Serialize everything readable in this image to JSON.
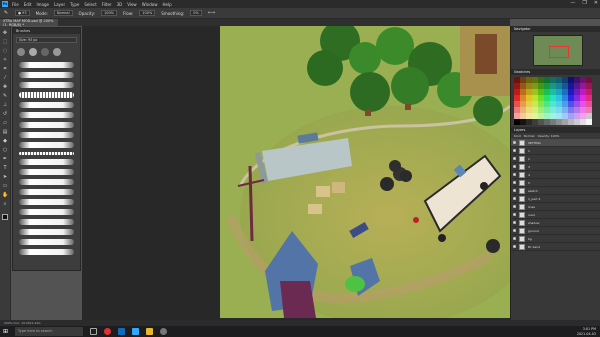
{
  "app": {
    "logo": "Ps",
    "window_controls": [
      "—",
      "❐",
      "✕"
    ]
  },
  "menu": [
    "File",
    "Edit",
    "Image",
    "Layer",
    "Type",
    "Select",
    "Filter",
    "3D",
    "View",
    "Window",
    "Help"
  ],
  "options": {
    "mode_label": "Mode:",
    "mode_value": "Normal",
    "opacity_label": "Opacity:",
    "opacity_value": "100%",
    "flow_label": "Flow:",
    "flow_value": "100%",
    "smoothing_label": "Smoothing:",
    "smoothing_value": "0%"
  },
  "document": {
    "tab_title": "XTRA MAP MOD.psd @ 200% (1, RGB/8) *"
  },
  "tools": [
    "move-icon",
    "marquee-icon",
    "lasso-icon",
    "magic-wand-icon",
    "crop-icon",
    "eyedropper-icon",
    "healing-icon",
    "brush-icon",
    "stamp-icon",
    "history-brush-icon",
    "eraser-icon",
    "gradient-icon",
    "blur-icon",
    "dodge-icon",
    "pen-icon",
    "type-icon",
    "path-select-icon",
    "rectangle-icon",
    "hand-icon",
    "zoom-icon"
  ],
  "brushes": {
    "title": "Brushes",
    "size_label": "Size:",
    "size_value": "93 px",
    "stroke_count": 20
  },
  "navigator": {
    "title": "Navigator"
  },
  "swatches": {
    "title": "Swatches"
  },
  "layers": {
    "title": "Layers",
    "kind_label": "Kind",
    "blend": "Normal",
    "opacity": "Opacity: 100%",
    "items": [
      {
        "name": "SETTING",
        "selected": true
      },
      {
        "name": "1",
        "selected": false
      },
      {
        "name": "2",
        "selected": false
      },
      {
        "name": "3",
        "selected": false
      },
      {
        "name": "4",
        "selected": false
      },
      {
        "name": "5",
        "selected": false
      },
      {
        "name": "sketch",
        "selected": false
      },
      {
        "name": "1_part 4",
        "selected": false
      },
      {
        "name": "lines",
        "selected": false
      },
      {
        "name": "road",
        "selected": false
      },
      {
        "name": "shadow",
        "selected": false
      },
      {
        "name": "ground",
        "selected": false
      },
      {
        "name": "bg",
        "selected": false
      },
      {
        "name": "Bc kand",
        "selected": false
      }
    ]
  },
  "status": {
    "text": "200%     Doc: 10.0M/1.44G"
  },
  "taskbar": {
    "search_placeholder": "Type here to search",
    "time": "3:01 PM",
    "date": "2021-04-03"
  }
}
